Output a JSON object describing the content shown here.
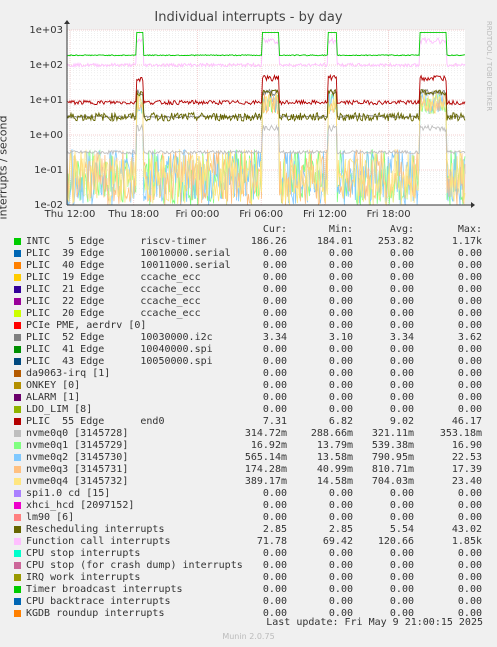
{
  "page": {
    "watermark": "RRDTOOL / TOBI OETIKER",
    "footer": "Munin 2.0.75",
    "last_update": "Last update: Fri May  9 21:00:15 2025",
    "table_headers": {
      "cur": "Cur:",
      "min": "Min:",
      "avg": "Avg:",
      "max": "Max:"
    }
  },
  "chart_data": {
    "type": "line",
    "title": "Individual interrupts - by day",
    "ylabel": "interrupts / second",
    "yscale": "log",
    "ylim": [
      0.01,
      1000
    ],
    "ytick_labels": [
      "1e-02",
      "1e-01",
      "1e+00",
      "1e+01",
      "1e+02",
      "1e+03"
    ],
    "xtick_labels": [
      "Thu 12:00",
      "Thu 18:00",
      "Fri 00:00",
      "Fri 06:00",
      "Fri 12:00",
      "Fri 18:00"
    ],
    "grid": true,
    "legend_position": "bottom",
    "series": [
      {
        "name": "INTC   5 Edge      riscv-timer",
        "color": "#00cc00",
        "cur": "186.26",
        "min": "184.01",
        "avg": "253.82",
        "max": "1.17k"
      },
      {
        "name": "PLIC  39 Edge      10010000.serial",
        "color": "#0066b3",
        "cur": "0.00",
        "min": "0.00",
        "avg": "0.00",
        "max": "0.00"
      },
      {
        "name": "PLIC  40 Edge      10011000.serial",
        "color": "#ff8000",
        "cur": "0.00",
        "min": "0.00",
        "avg": "0.00",
        "max": "0.00"
      },
      {
        "name": "PLIC  19 Edge      ccache_ecc",
        "color": "#ffcc00",
        "cur": "0.00",
        "min": "0.00",
        "avg": "0.00",
        "max": "0.00"
      },
      {
        "name": "PLIC  21 Edge      ccache_ecc",
        "color": "#330099",
        "cur": "0.00",
        "min": "0.00",
        "avg": "0.00",
        "max": "0.00"
      },
      {
        "name": "PLIC  22 Edge      ccache_ecc",
        "color": "#990099",
        "cur": "0.00",
        "min": "0.00",
        "avg": "0.00",
        "max": "0.00"
      },
      {
        "name": "PLIC  20 Edge      ccache_ecc",
        "color": "#ccff00",
        "cur": "0.00",
        "min": "0.00",
        "avg": "0.00",
        "max": "0.00"
      },
      {
        "name": "PCIe PME, aerdrv [0]",
        "color": "#ff0000",
        "cur": "0.00",
        "min": "0.00",
        "avg": "0.00",
        "max": "0.00"
      },
      {
        "name": "PLIC  52 Edge      10030000.i2c",
        "color": "#808080",
        "cur": "3.34",
        "min": "3.10",
        "avg": "3.34",
        "max": "3.62"
      },
      {
        "name": "PLIC  41 Edge      10040000.spi",
        "color": "#008f00",
        "cur": "0.00",
        "min": "0.00",
        "avg": "0.00",
        "max": "0.00"
      },
      {
        "name": "PLIC  43 Edge      10050000.spi",
        "color": "#00487d",
        "cur": "0.00",
        "min": "0.00",
        "avg": "0.00",
        "max": "0.00"
      },
      {
        "name": "da9063-irq [1]",
        "color": "#b35a00",
        "cur": "0.00",
        "min": "0.00",
        "avg": "0.00",
        "max": "0.00"
      },
      {
        "name": "ONKEY [0]",
        "color": "#b38f00",
        "cur": "0.00",
        "min": "0.00",
        "avg": "0.00",
        "max": "0.00"
      },
      {
        "name": "ALARM [1]",
        "color": "#6b006b",
        "cur": "0.00",
        "min": "0.00",
        "avg": "0.00",
        "max": "0.00"
      },
      {
        "name": "LDO_LIM [8]",
        "color": "#8fb300",
        "cur": "0.00",
        "min": "0.00",
        "avg": "0.00",
        "max": "0.00"
      },
      {
        "name": "PLIC  55 Edge      end0",
        "color": "#b30000",
        "cur": "7.31",
        "min": "6.82",
        "avg": "9.02",
        "max": "46.17"
      },
      {
        "name": "nvme0q0 [3145728]",
        "color": "#bebebe",
        "cur": "314.72m",
        "min": "288.66m",
        "avg": "321.11m",
        "max": "353.18m"
      },
      {
        "name": "nvme0q1 [3145729]",
        "color": "#80ff80",
        "cur": "16.92m",
        "min": "13.79m",
        "avg": "539.38m",
        "max": "16.90"
      },
      {
        "name": "nvme0q2 [3145730]",
        "color": "#80c9ff",
        "cur": "565.14m",
        "min": "13.58m",
        "avg": "790.95m",
        "max": "22.53"
      },
      {
        "name": "nvme0q3 [3145731]",
        "color": "#ffc080",
        "cur": "174.28m",
        "min": "40.99m",
        "avg": "810.71m",
        "max": "17.39"
      },
      {
        "name": "nvme0q4 [3145732]",
        "color": "#ffe680",
        "cur": "389.17m",
        "min": "14.58m",
        "avg": "704.03m",
        "max": "23.40"
      },
      {
        "name": "spi1.0 cd [15]",
        "color": "#aa80ff",
        "cur": "0.00",
        "min": "0.00",
        "avg": "0.00",
        "max": "0.00"
      },
      {
        "name": "xhci_hcd [2097152]",
        "color": "#ee00cc",
        "cur": "0.00",
        "min": "0.00",
        "avg": "0.00",
        "max": "0.00"
      },
      {
        "name": "lm90 [6]",
        "color": "#ff8080",
        "cur": "0.00",
        "min": "0.00",
        "avg": "0.00",
        "max": "0.00"
      },
      {
        "name": "Rescheduling interrupts",
        "color": "#666600",
        "cur": "2.85",
        "min": "2.85",
        "avg": "5.54",
        "max": "43.02"
      },
      {
        "name": "Function call interrupts",
        "color": "#ffbfff",
        "cur": "71.78",
        "min": "69.42",
        "avg": "120.66",
        "max": "1.85k"
      },
      {
        "name": "CPU stop interrupts",
        "color": "#00ffcc",
        "cur": "0.00",
        "min": "0.00",
        "avg": "0.00",
        "max": "0.00"
      },
      {
        "name": "CPU stop (for crash dump) interrupts",
        "color": "#cc6699",
        "cur": "0.00",
        "min": "0.00",
        "avg": "0.00",
        "max": "0.00"
      },
      {
        "name": "IRQ work interrupts",
        "color": "#999900",
        "cur": "0.00",
        "min": "0.00",
        "avg": "0.00",
        "max": "0.00"
      },
      {
        "name": "Timer broadcast interrupts",
        "color": "#00cc00",
        "cur": "0.00",
        "min": "0.00",
        "avg": "0.00",
        "max": "0.00"
      },
      {
        "name": "CPU backtrace interrupts",
        "color": "#0066b3",
        "cur": "0.00",
        "min": "0.00",
        "avg": "0.00",
        "max": "0.00"
      },
      {
        "name": "KGDB roundup interrupts",
        "color": "#ff8000",
        "cur": "0.00",
        "min": "0.00",
        "avg": "0.00",
        "max": "0.00"
      }
    ],
    "lines": [
      {
        "series": "INTC   5 Edge      riscv-timer",
        "y": [
          185,
          185,
          185,
          185,
          185,
          185,
          185,
          185,
          185,
          185,
          185,
          185,
          185,
          185,
          185,
          185,
          185,
          185,
          185,
          185,
          185,
          185,
          185,
          185,
          185,
          185,
          185,
          185,
          185,
          185,
          185,
          185,
          185,
          185,
          185,
          185,
          185,
          185,
          185,
          185,
          185,
          185,
          185,
          185,
          185,
          185,
          185,
          185,
          185,
          185,
          185,
          185,
          185,
          185,
          185,
          185,
          185,
          185,
          185,
          185,
          185,
          185,
          185,
          185,
          185,
          185,
          185,
          185,
          185,
          185,
          185,
          185,
          185,
          185,
          185,
          185,
          185,
          185,
          185,
          185,
          185,
          185,
          185,
          185,
          185,
          185,
          185,
          185,
          185,
          185,
          185,
          185,
          185,
          185,
          185,
          185,
          185,
          185,
          185,
          185,
          185,
          185,
          185,
          185,
          185,
          185,
          185,
          185,
          185,
          185,
          185,
          185,
          185,
          185,
          185,
          185,
          185,
          185,
          185,
          185,
          185,
          185,
          185,
          185,
          185,
          185,
          185,
          185,
          185,
          185,
          185,
          185,
          185,
          185,
          185,
          185,
          185,
          185,
          185,
          185,
          185,
          185,
          185,
          185,
          185,
          185,
          185,
          185,
          185,
          185,
          185,
          185,
          185,
          185,
          185,
          185,
          185,
          185,
          185,
          185,
          185,
          185,
          185,
          185,
          185,
          185,
          185,
          185,
          185,
          185,
          185,
          185,
          185,
          185,
          185,
          185,
          185,
          185,
          185,
          185,
          185,
          185,
          185,
          185,
          185,
          185,
          185,
          185,
          185,
          185,
          185,
          185,
          185,
          185,
          185,
          185,
          185,
          185,
          185,
          185,
          185,
          185,
          185,
          185,
          185,
          185,
          185,
          185,
          185,
          185,
          185,
          185,
          185,
          185,
          185,
          185,
          185,
          185,
          185,
          185,
          185,
          185,
          185,
          185,
          185,
          185,
          185,
          185,
          185,
          185,
          185,
          185,
          185,
          185,
          185,
          185,
          185,
          185,
          185,
          185,
          185,
          185,
          185,
          185,
          185,
          185,
          185,
          185,
          185,
          185,
          185,
          185,
          185,
          185,
          185,
          185,
          185,
          185,
          185,
          185,
          185,
          185,
          185,
          185,
          185,
          185,
          185,
          185,
          185,
          185,
          185,
          185,
          185,
          185,
          185,
          185,
          185,
          185,
          185,
          185,
          185,
          185,
          185,
          185,
          185,
          185,
          185,
          185,
          185,
          185,
          185,
          185,
          185,
          185,
          185,
          185,
          185,
          185,
          185,
          185,
          185,
          185,
          185,
          185,
          185,
          185,
          185,
          185,
          185,
          185,
          185,
          185,
          185,
          185,
          185,
          185,
          185,
          185,
          185,
          185,
          185,
          185,
          185,
          185,
          185,
          185,
          185,
          185,
          185,
          185,
          185,
          185,
          185,
          185,
          185,
          185,
          185,
          185,
          185,
          185,
          185,
          185,
          185,
          185,
          185,
          185,
          185,
          185,
          185,
          185,
          185,
          185,
          185,
          185,
          185,
          185,
          185,
          185,
          185,
          185,
          185,
          185,
          185,
          185,
          185,
          185,
          185,
          185,
          185,
          185,
          185,
          185,
          185,
          185,
          185,
          185,
          185,
          185,
          185,
          185,
          185,
          185,
          185,
          185,
          185,
          185,
          185,
          185,
          185,
          185,
          185,
          185,
          185,
          185,
          185,
          185,
          185,
          185,
          185,
          185,
          185,
          185,
          185,
          185,
          185,
          185,
          185,
          185,
          185,
          185,
          185,
          185,
          185,
          185,
          185,
          185,
          185,
          185,
          185
        ]
      }
    ]
  }
}
